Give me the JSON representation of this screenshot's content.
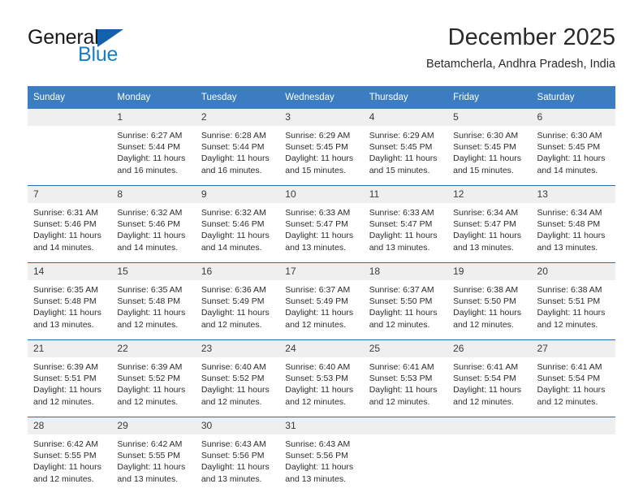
{
  "brand": {
    "name_part1": "General",
    "name_part2": "Blue",
    "triangle_color": "#1161ad",
    "blue_color": "#1b7ec1"
  },
  "header": {
    "title": "December 2025",
    "location": "Betamcherla, Andhra Pradesh, India"
  },
  "theme": {
    "header_row_background": "#3b7dc0",
    "header_row_text": "#ffffff",
    "daynum_background": "#efefef",
    "row_divider": "#2c6ba8",
    "page_background": "#ffffff"
  },
  "weekday_headers": [
    "Sunday",
    "Monday",
    "Tuesday",
    "Wednesday",
    "Thursday",
    "Friday",
    "Saturday"
  ],
  "labels": {
    "sunrise_prefix": "Sunrise:",
    "sunset_prefix": "Sunset:",
    "daylight_prefix": "Daylight:"
  },
  "weeks": [
    [
      {
        "day": "",
        "line1": "",
        "line2": "",
        "line3": "",
        "line4": ""
      },
      {
        "day": "1",
        "line1": "Sunrise: 6:27 AM",
        "line2": "Sunset: 5:44 PM",
        "line3": "Daylight: 11 hours",
        "line4": "and 16 minutes."
      },
      {
        "day": "2",
        "line1": "Sunrise: 6:28 AM",
        "line2": "Sunset: 5:44 PM",
        "line3": "Daylight: 11 hours",
        "line4": "and 16 minutes."
      },
      {
        "day": "3",
        "line1": "Sunrise: 6:29 AM",
        "line2": "Sunset: 5:45 PM",
        "line3": "Daylight: 11 hours",
        "line4": "and 15 minutes."
      },
      {
        "day": "4",
        "line1": "Sunrise: 6:29 AM",
        "line2": "Sunset: 5:45 PM",
        "line3": "Daylight: 11 hours",
        "line4": "and 15 minutes."
      },
      {
        "day": "5",
        "line1": "Sunrise: 6:30 AM",
        "line2": "Sunset: 5:45 PM",
        "line3": "Daylight: 11 hours",
        "line4": "and 15 minutes."
      },
      {
        "day": "6",
        "line1": "Sunrise: 6:30 AM",
        "line2": "Sunset: 5:45 PM",
        "line3": "Daylight: 11 hours",
        "line4": "and 14 minutes."
      }
    ],
    [
      {
        "day": "7",
        "line1": "Sunrise: 6:31 AM",
        "line2": "Sunset: 5:46 PM",
        "line3": "Daylight: 11 hours",
        "line4": "and 14 minutes."
      },
      {
        "day": "8",
        "line1": "Sunrise: 6:32 AM",
        "line2": "Sunset: 5:46 PM",
        "line3": "Daylight: 11 hours",
        "line4": "and 14 minutes."
      },
      {
        "day": "9",
        "line1": "Sunrise: 6:32 AM",
        "line2": "Sunset: 5:46 PM",
        "line3": "Daylight: 11 hours",
        "line4": "and 14 minutes."
      },
      {
        "day": "10",
        "line1": "Sunrise: 6:33 AM",
        "line2": "Sunset: 5:47 PM",
        "line3": "Daylight: 11 hours",
        "line4": "and 13 minutes."
      },
      {
        "day": "11",
        "line1": "Sunrise: 6:33 AM",
        "line2": "Sunset: 5:47 PM",
        "line3": "Daylight: 11 hours",
        "line4": "and 13 minutes."
      },
      {
        "day": "12",
        "line1": "Sunrise: 6:34 AM",
        "line2": "Sunset: 5:47 PM",
        "line3": "Daylight: 11 hours",
        "line4": "and 13 minutes."
      },
      {
        "day": "13",
        "line1": "Sunrise: 6:34 AM",
        "line2": "Sunset: 5:48 PM",
        "line3": "Daylight: 11 hours",
        "line4": "and 13 minutes."
      }
    ],
    [
      {
        "day": "14",
        "line1": "Sunrise: 6:35 AM",
        "line2": "Sunset: 5:48 PM",
        "line3": "Daylight: 11 hours",
        "line4": "and 13 minutes."
      },
      {
        "day": "15",
        "line1": "Sunrise: 6:35 AM",
        "line2": "Sunset: 5:48 PM",
        "line3": "Daylight: 11 hours",
        "line4": "and 12 minutes."
      },
      {
        "day": "16",
        "line1": "Sunrise: 6:36 AM",
        "line2": "Sunset: 5:49 PM",
        "line3": "Daylight: 11 hours",
        "line4": "and 12 minutes."
      },
      {
        "day": "17",
        "line1": "Sunrise: 6:37 AM",
        "line2": "Sunset: 5:49 PM",
        "line3": "Daylight: 11 hours",
        "line4": "and 12 minutes."
      },
      {
        "day": "18",
        "line1": "Sunrise: 6:37 AM",
        "line2": "Sunset: 5:50 PM",
        "line3": "Daylight: 11 hours",
        "line4": "and 12 minutes."
      },
      {
        "day": "19",
        "line1": "Sunrise: 6:38 AM",
        "line2": "Sunset: 5:50 PM",
        "line3": "Daylight: 11 hours",
        "line4": "and 12 minutes."
      },
      {
        "day": "20",
        "line1": "Sunrise: 6:38 AM",
        "line2": "Sunset: 5:51 PM",
        "line3": "Daylight: 11 hours",
        "line4": "and 12 minutes."
      }
    ],
    [
      {
        "day": "21",
        "line1": "Sunrise: 6:39 AM",
        "line2": "Sunset: 5:51 PM",
        "line3": "Daylight: 11 hours",
        "line4": "and 12 minutes."
      },
      {
        "day": "22",
        "line1": "Sunrise: 6:39 AM",
        "line2": "Sunset: 5:52 PM",
        "line3": "Daylight: 11 hours",
        "line4": "and 12 minutes."
      },
      {
        "day": "23",
        "line1": "Sunrise: 6:40 AM",
        "line2": "Sunset: 5:52 PM",
        "line3": "Daylight: 11 hours",
        "line4": "and 12 minutes."
      },
      {
        "day": "24",
        "line1": "Sunrise: 6:40 AM",
        "line2": "Sunset: 5:53 PM",
        "line3": "Daylight: 11 hours",
        "line4": "and 12 minutes."
      },
      {
        "day": "25",
        "line1": "Sunrise: 6:41 AM",
        "line2": "Sunset: 5:53 PM",
        "line3": "Daylight: 11 hours",
        "line4": "and 12 minutes."
      },
      {
        "day": "26",
        "line1": "Sunrise: 6:41 AM",
        "line2": "Sunset: 5:54 PM",
        "line3": "Daylight: 11 hours",
        "line4": "and 12 minutes."
      },
      {
        "day": "27",
        "line1": "Sunrise: 6:41 AM",
        "line2": "Sunset: 5:54 PM",
        "line3": "Daylight: 11 hours",
        "line4": "and 12 minutes."
      }
    ],
    [
      {
        "day": "28",
        "line1": "Sunrise: 6:42 AM",
        "line2": "Sunset: 5:55 PM",
        "line3": "Daylight: 11 hours",
        "line4": "and 12 minutes."
      },
      {
        "day": "29",
        "line1": "Sunrise: 6:42 AM",
        "line2": "Sunset: 5:55 PM",
        "line3": "Daylight: 11 hours",
        "line4": "and 13 minutes."
      },
      {
        "day": "30",
        "line1": "Sunrise: 6:43 AM",
        "line2": "Sunset: 5:56 PM",
        "line3": "Daylight: 11 hours",
        "line4": "and 13 minutes."
      },
      {
        "day": "31",
        "line1": "Sunrise: 6:43 AM",
        "line2": "Sunset: 5:56 PM",
        "line3": "Daylight: 11 hours",
        "line4": "and 13 minutes."
      },
      {
        "day": "",
        "line1": "",
        "line2": "",
        "line3": "",
        "line4": ""
      },
      {
        "day": "",
        "line1": "",
        "line2": "",
        "line3": "",
        "line4": ""
      },
      {
        "day": "",
        "line1": "",
        "line2": "",
        "line3": "",
        "line4": ""
      }
    ]
  ]
}
